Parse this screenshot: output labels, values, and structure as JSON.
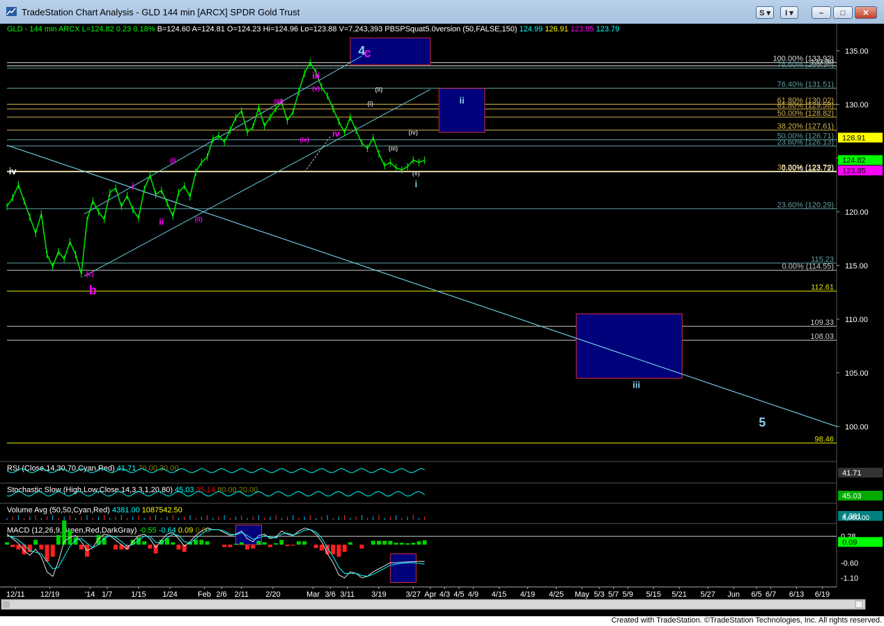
{
  "window": {
    "title": "TradeStation Chart Analysis - GLD 144 min [ARCX] SPDR Gold Trust",
    "buttons": {
      "s": "S",
      "i": "I",
      "minimize": "–",
      "maximize": "□",
      "close": "✕"
    }
  },
  "header": {
    "parts": [
      {
        "text": "GLD - 144 min",
        "color": "#00ff00"
      },
      {
        "text": "ARCX",
        "color": "#00ff00"
      },
      {
        "text": "L=124.82",
        "color": "#00ff00"
      },
      {
        "text": "0.23",
        "color": "#00ff00"
      },
      {
        "text": "0.18%",
        "color": "#00ff00"
      },
      {
        "text": "B=124.60",
        "color": "#ffffff"
      },
      {
        "text": "A=124.81",
        "color": "#ffffff"
      },
      {
        "text": "O=124.23",
        "color": "#ffffff"
      },
      {
        "text": "Hi=124.96",
        "color": "#ffffff"
      },
      {
        "text": "Lo=123.88",
        "color": "#ffffff"
      },
      {
        "text": "V=7,243,393",
        "color": "#ffffff"
      },
      {
        "text": "PBSPSquat5.0version (50,FALSE,150)",
        "color": "#ffffff"
      },
      {
        "text": "124.99",
        "color": "#00ffff"
      },
      {
        "text": "126.91",
        "color": "#ffff00"
      },
      {
        "text": "123.85",
        "color": "#ff00ff"
      },
      {
        "text": "123.79",
        "color": "#00ffff"
      }
    ]
  },
  "credit": "Created with TradeStation. ©TradeStation Technologies, Inc. All rights reserved.",
  "chart_data": [
    {
      "type": "line",
      "name": "price",
      "ylim": [
        97,
        137
      ],
      "yticks": [
        135,
        130,
        125,
        120,
        115,
        110,
        105,
        100
      ],
      "x": [
        0,
        2,
        4,
        6,
        8,
        10,
        12,
        14,
        16,
        18,
        20,
        22,
        24,
        26,
        28,
        30,
        32,
        34,
        36,
        38,
        40,
        42,
        44,
        46,
        48,
        50,
        52,
        54,
        56,
        58,
        60,
        62,
        64,
        66,
        68,
        70,
        72,
        74,
        76,
        78,
        80,
        82,
        84,
        86,
        88,
        90,
        92,
        94,
        96,
        98,
        100,
        102,
        104,
        106,
        108,
        110,
        112,
        114,
        116,
        118,
        120,
        122,
        124,
        126,
        128,
        130,
        132,
        134,
        136,
        138,
        140,
        142,
        144,
        146
      ],
      "values": [
        120.5,
        121.3,
        122.5,
        121.0,
        119.5,
        118.0,
        119.8,
        116.0,
        114.9,
        116.3,
        115.6,
        117.2,
        116.0,
        114.2,
        119.2,
        121.0,
        120.0,
        119.3,
        121.8,
        122.2,
        120.5,
        121.5,
        120.2,
        119.4,
        122.1,
        123.4,
        121.6,
        122.0,
        120.8,
        119.6,
        121.8,
        122.4,
        121.4,
        123.7,
        124.6,
        125.1,
        126.8,
        127.1,
        126.5,
        127.6,
        128.8,
        129.4,
        127.4,
        127.9,
        129.7,
        128.0,
        128.8,
        129.6,
        130.2,
        128.5,
        129.3,
        131.2,
        132.9,
        133.9,
        133.0,
        131.6,
        130.8,
        129.6,
        128.4,
        127.4,
        128.8,
        127.6,
        126.4,
        125.9,
        126.9,
        125.4,
        124.3,
        124.6,
        124.1,
        123.9,
        124.2,
        124.82,
        124.6,
        124.8
      ],
      "horizontal_levels": [
        {
          "value": 133.9,
          "label": "100.00% (133.92)",
          "color": "#dddddd"
        },
        {
          "value": 133.59,
          "label": "133.59",
          "color": "#dddddd"
        },
        {
          "value": 133.37,
          "label": "78.60% (133.37)",
          "color": "#5f9ea0"
        },
        {
          "value": 131.51,
          "label": "76.40% (131.51)",
          "color": "#5f9ea0"
        },
        {
          "value": 130.02,
          "label": "61.80% (130.02)",
          "color": "#d2b24c"
        },
        {
          "value": 129.58,
          "label": "61.80% (129.58)",
          "color": "#d2b24c"
        },
        {
          "value": 128.82,
          "label": "50.00% (128.82)",
          "color": "#d2b24c"
        },
        {
          "value": 127.61,
          "label": "38.20% (127.61)",
          "color": "#d2b24c"
        },
        {
          "value": 126.71,
          "label": "50.00% (126.71)",
          "color": "#5f9ea0"
        },
        {
          "value": 126.13,
          "label": "23.60% (126.13)",
          "color": "#5f9ea0"
        },
        {
          "value": 123.79,
          "label": "38.20% (123.79)",
          "color": "#d2b24c"
        },
        {
          "value": 123.72,
          "label": "0.00% (123.72)",
          "color": "#ffffff"
        },
        {
          "value": 120.29,
          "label": "23.60% (120.29)",
          "color": "#5f9ea0"
        },
        {
          "value": 115.23,
          "label": "115.23",
          "color": "#5f9ea0"
        },
        {
          "value": 114.55,
          "label": "0.00% (114.55)",
          "color": "#cccccc"
        },
        {
          "value": 112.61,
          "label": "112.61",
          "color": "#e8e800"
        },
        {
          "value": 109.33,
          "label": "109.33",
          "color": "#cccccc"
        },
        {
          "value": 108.03,
          "label": "108.03",
          "color": "#cccccc"
        },
        {
          "value": 98.46,
          "label": "98.46",
          "color": "#e8e800"
        }
      ],
      "right_axis_badges": [
        {
          "value": 126.91,
          "label": "126.91",
          "bg": "#ffff00",
          "fg": "#000000"
        },
        {
          "value": 124.82,
          "label": "124.82",
          "bg": "#00ff00",
          "fg": "#000000"
        },
        {
          "value": 123.85,
          "label": "123.85",
          "bg": "#ff00ff",
          "fg": "#000000"
        }
      ],
      "target_boxes": [
        {
          "x0": 120,
          "x1": 148,
          "y0": 133.7,
          "y1": 136.2
        },
        {
          "x0": 151,
          "x1": 167,
          "y0": 127.4,
          "y1": 131.5
        },
        {
          "x0": 199,
          "x1": 236,
          "y0": 104.5,
          "y1": 110.5
        }
      ],
      "wave_labels": [
        {
          "text": "4",
          "x": 124,
          "y": 134.6,
          "color": "#87ceeb"
        },
        {
          "text": "c",
          "x": 126,
          "y": 134.4,
          "color": "#ff00ff"
        },
        {
          "text": "iii",
          "x": 108,
          "y": 132.4,
          "color": "#ff00ff"
        },
        {
          "text": "(v)",
          "x": 108,
          "y": 131.3,
          "color": "#ff00ff"
        },
        {
          "text": "(iii)",
          "x": 95,
          "y": 130.1,
          "color": "#ff00ff"
        },
        {
          "text": "(ii)",
          "x": 130,
          "y": 131.2,
          "color": "#bbbbbb"
        },
        {
          "text": "(i)",
          "x": 127,
          "y": 129.9,
          "color": "#bbbbbb"
        },
        {
          "text": "iv",
          "x": 115,
          "y": 127.0,
          "color": "#ff00ff"
        },
        {
          "text": "(iv)",
          "x": 104,
          "y": 126.5,
          "color": "#ff00ff"
        },
        {
          "text": "(iv)",
          "x": 142,
          "y": 127.2,
          "color": "#bbbbbb"
        },
        {
          "text": "(iii)",
          "x": 135,
          "y": 125.7,
          "color": "#bbbbbb"
        },
        {
          "text": "(v)",
          "x": 143,
          "y": 123.4,
          "color": "#bbbbbb"
        },
        {
          "text": "i",
          "x": 143,
          "y": 122.3,
          "color": "#87ceeb"
        },
        {
          "text": "ii",
          "x": 159,
          "y": 130.1,
          "color": "#87ceeb"
        },
        {
          "text": "iii",
          "x": 220,
          "y": 103.6,
          "color": "#87ceeb"
        },
        {
          "text": "5",
          "x": 264,
          "y": 100.0,
          "color": "#87ceeb"
        },
        {
          "text": "iv",
          "x": 2,
          "y": 123.5,
          "color": "#ffffff"
        },
        {
          "text": "i",
          "x": 44,
          "y": 122.1,
          "color": "#ff00ff"
        },
        {
          "text": "(i)",
          "x": 58,
          "y": 124.6,
          "color": "#ff00ff"
        },
        {
          "text": "ii",
          "x": 54,
          "y": 118.8,
          "color": "#ff00ff"
        },
        {
          "text": "(ii)",
          "x": 67,
          "y": 119.1,
          "color": "#ff00ff"
        },
        {
          "text": "(c)",
          "x": 29,
          "y": 114.0,
          "color": "#ff00ff"
        },
        {
          "text": "b",
          "x": 30,
          "y": 112.3,
          "color": "#ff00ff"
        }
      ],
      "x_ticks": [
        {
          "x": 3,
          "label": "12/11"
        },
        {
          "x": 15,
          "label": "12/19"
        },
        {
          "x": 29,
          "label": "'14"
        },
        {
          "x": 35,
          "label": "1/7"
        },
        {
          "x": 46,
          "label": "1/15"
        },
        {
          "x": 57,
          "label": "1/24"
        },
        {
          "x": 69,
          "label": "Feb"
        },
        {
          "x": 75,
          "label": "2/6"
        },
        {
          "x": 82,
          "label": "2/11"
        },
        {
          "x": 93,
          "label": "2/20"
        },
        {
          "x": 107,
          "label": "Mar"
        },
        {
          "x": 113,
          "label": "3/6"
        },
        {
          "x": 119,
          "label": "3/11"
        },
        {
          "x": 130,
          "label": "3/19"
        },
        {
          "x": 142,
          "label": "3/27"
        },
        {
          "x": 148,
          "label": "Apr"
        },
        {
          "x": 153,
          "label": "4/3"
        },
        {
          "x": 158,
          "label": "4/5"
        },
        {
          "x": 163,
          "label": "4/9"
        },
        {
          "x": 172,
          "label": "4/15"
        },
        {
          "x": 182,
          "label": "4/19"
        },
        {
          "x": 192,
          "label": "4/25"
        },
        {
          "x": 201,
          "label": "May"
        },
        {
          "x": 207,
          "label": "5/3"
        },
        {
          "x": 212,
          "label": "5/7"
        },
        {
          "x": 217,
          "label": "5/9"
        },
        {
          "x": 226,
          "label": "5/15"
        },
        {
          "x": 235,
          "label": "5/21"
        },
        {
          "x": 245,
          "label": "5/27"
        },
        {
          "x": 254,
          "label": "Jun"
        },
        {
          "x": 262,
          "label": "6/5"
        },
        {
          "x": 267,
          "label": "6/7"
        },
        {
          "x": 276,
          "label": "6/13"
        },
        {
          "x": 285,
          "label": "6/19"
        }
      ]
    },
    {
      "type": "line",
      "name": "RSI",
      "header": [
        {
          "text": "RSI (Close,14,30,70,Cyan,Red)",
          "color": "#ffffff"
        },
        {
          "text": "41.71",
          "color": "#00ffff"
        },
        {
          "text": "70.00",
          "color": "#808000"
        },
        {
          "text": "30.00",
          "color": "#808000"
        }
      ],
      "badge": {
        "label": "41.71",
        "bg": "#333333",
        "fg": "#ffffff"
      }
    },
    {
      "type": "line",
      "name": "Stochastic Slow",
      "header": [
        {
          "text": "Stochastic Slow (High,Low,Close,14,3,3,1,20,80)",
          "color": "#ffffff"
        },
        {
          "text": "45.03",
          "color": "#00ffff"
        },
        {
          "text": "35.14",
          "color": "#ff0000"
        },
        {
          "text": "80.00",
          "color": "#808000"
        },
        {
          "text": "20.00",
          "color": "#808000"
        }
      ],
      "badge": {
        "label": "45.03",
        "bg": "#00aa00",
        "fg": "#ffffff"
      }
    },
    {
      "type": "bar",
      "name": "Volume Avg",
      "header": [
        {
          "text": "Volume Avg (50,50,Cyan,Red)",
          "color": "#ffffff"
        },
        {
          "text": "4381.00",
          "color": "#00ffff"
        },
        {
          "text": "1087542.50",
          "color": "#ffff00"
        }
      ],
      "axis_label": "4,000.00",
      "badge": {
        "label": "4,381",
        "bg": "#008080",
        "fg": "#ffffff"
      }
    },
    {
      "type": "line",
      "name": "MACD",
      "header": [
        {
          "text": "MACD (12,26,9,Green,Red,DarkGray)",
          "color": "#ffffff"
        },
        {
          "text": "-0.55",
          "color": "#00ff00"
        },
        {
          "text": "-0.64",
          "color": "#00ffff"
        },
        {
          "text": "0.09",
          "color": "#ffff00"
        },
        {
          "text": "0.00",
          "color": "#808000"
        }
      ],
      "ylim": [
        -1.4,
        0.7
      ],
      "axis_labels": [
        {
          "value": 0.28,
          "label": "0.28"
        },
        {
          "value": -0.6,
          "label": "-0.60"
        },
        {
          "value": -1.1,
          "label": "-1.10"
        }
      ],
      "badge": {
        "value": 0.09,
        "label": "0.09",
        "bg": "#00ff00",
        "fg": "#000000"
      },
      "values": [
        0.35,
        0.2,
        0.05,
        -0.2,
        -0.35,
        -0.15,
        -0.4,
        -0.9,
        -1.05,
        -0.55,
        0.1,
        0.25,
        0.3,
        0.1,
        -0.2,
        -0.1,
        0.2,
        0.35,
        0.3,
        0.15,
        0.0,
        -0.15,
        0.1,
        0.3,
        0.35,
        0.2,
        -0.1,
        0.15,
        0.35,
        0.4,
        0.2,
        -0.05,
        0.1,
        0.3,
        0.45,
        0.55,
        0.5,
        0.5,
        0.4,
        0.3,
        0.35,
        0.45,
        0.2,
        0.1,
        0.3,
        0.35,
        0.2,
        0.25,
        0.45,
        0.35,
        0.3,
        0.45,
        0.55,
        0.5,
        0.35,
        0.1,
        -0.3,
        -0.6,
        -1.0,
        -1.1,
        -0.9,
        -0.95,
        -1.1,
        -1.05,
        -0.9,
        -0.8,
        -0.7,
        -0.6,
        -0.6,
        -0.58,
        -0.57,
        -0.56,
        -0.55,
        -0.55
      ],
      "signal": [
        0.3,
        0.25,
        0.15,
        0.0,
        -0.2,
        -0.25,
        -0.3,
        -0.55,
        -0.8,
        -0.75,
        -0.4,
        -0.05,
        0.15,
        0.2,
        0.05,
        -0.1,
        0.0,
        0.2,
        0.3,
        0.25,
        0.1,
        -0.05,
        0.0,
        0.15,
        0.28,
        0.28,
        0.08,
        0.05,
        0.22,
        0.35,
        0.3,
        0.1,
        0.05,
        0.2,
        0.35,
        0.48,
        0.5,
        0.5,
        0.45,
        0.35,
        0.33,
        0.4,
        0.3,
        0.18,
        0.22,
        0.3,
        0.25,
        0.22,
        0.35,
        0.38,
        0.32,
        0.38,
        0.48,
        0.5,
        0.42,
        0.22,
        -0.1,
        -0.4,
        -0.75,
        -0.95,
        -0.95,
        -0.95,
        -1.02,
        -1.05,
        -0.98,
        -0.88,
        -0.78,
        -0.68,
        -0.64,
        -0.62,
        -0.6,
        -0.6,
        -0.62,
        -0.64
      ],
      "boxes": [
        {
          "x0": 80,
          "x1": 89,
          "y0": 0.0,
          "y1": 0.65
        },
        {
          "x0": 134,
          "x1": 143,
          "y0": -1.25,
          "y1": -0.3
        }
      ]
    }
  ]
}
